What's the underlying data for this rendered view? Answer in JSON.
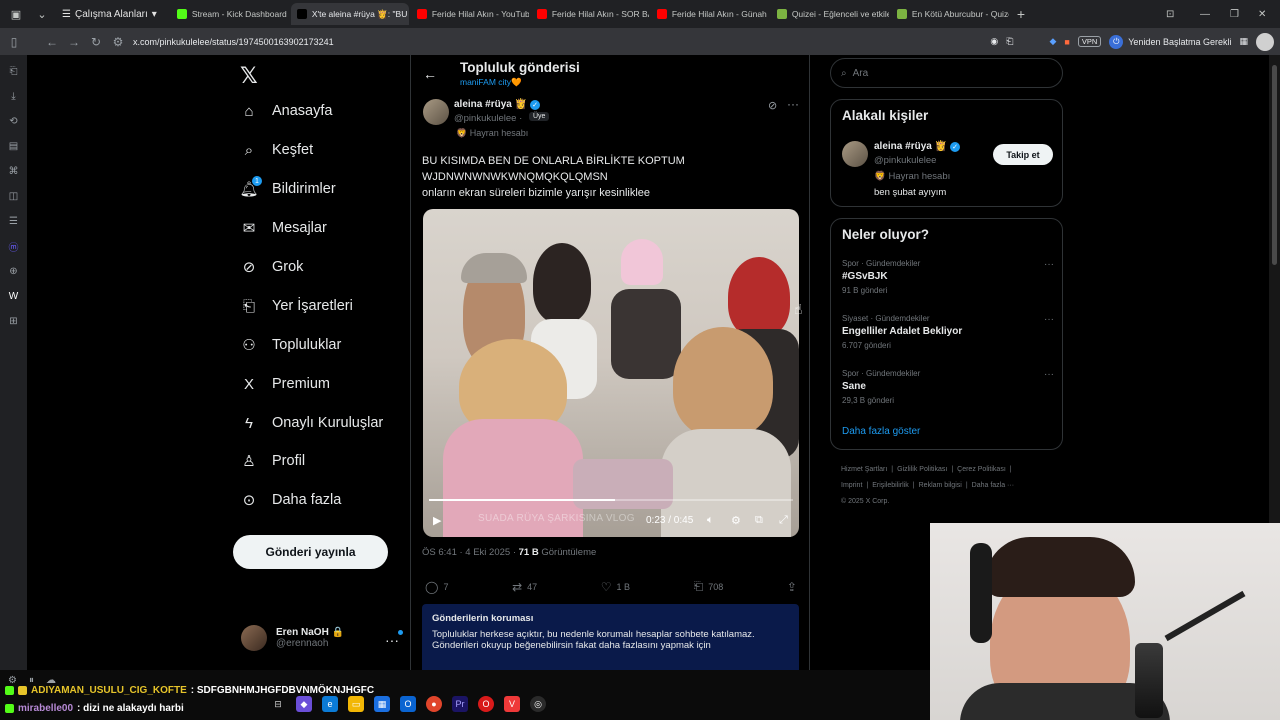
{
  "browser": {
    "workspace_label": "Çalışma Alanları",
    "tabs": [
      {
        "label": "Stream - Kick Dashboard",
        "color": "#53fc18",
        "active": false
      },
      {
        "label": "X'te aleina #rüya 👸: \"BU K",
        "color": "#000000",
        "active": true
      },
      {
        "label": "Feride Hilal Akın - YouTube",
        "color": "#ff0000",
        "active": false
      },
      {
        "label": "Feride Hilal Akın - SOR BAN",
        "color": "#ff0000",
        "active": false
      },
      {
        "label": "Feride Hilal Akın - Günah B",
        "color": "#ff0000",
        "active": false
      },
      {
        "label": "Quizei - Eğlenceli ve etkileş",
        "color": "#7cb342",
        "active": false
      },
      {
        "label": "En Kötü Aburcubur - Quizei",
        "color": "#7cb342",
        "active": false
      }
    ],
    "url": "x.com/pinkukulelee/status/1974500163902173241",
    "vpn_label": "VPN",
    "restart_label": "Yeniden Başlatma Gerekli"
  },
  "nav": {
    "items": [
      {
        "label": "Anasayfa",
        "icon": "home-icon",
        "glyph": "⌂"
      },
      {
        "label": "Keşfet",
        "icon": "search-icon",
        "glyph": "⌕"
      },
      {
        "label": "Bildirimler",
        "icon": "bell-icon",
        "glyph": "🔔︎"
      },
      {
        "label": "Mesajlar",
        "icon": "mail-icon",
        "glyph": "✉"
      },
      {
        "label": "Grok",
        "icon": "grok-icon",
        "glyph": "⊘"
      },
      {
        "label": "Yer İşaretleri",
        "icon": "bookmark-icon",
        "glyph": "⎗"
      },
      {
        "label": "Topluluklar",
        "icon": "communities-icon",
        "glyph": "⚇"
      },
      {
        "label": "Premium",
        "icon": "x-premium-icon",
        "glyph": "X"
      },
      {
        "label": "Onaylı Kuruluşlar",
        "icon": "lightning-icon",
        "glyph": "ϟ"
      },
      {
        "label": "Profil",
        "icon": "person-icon",
        "glyph": "♙"
      },
      {
        "label": "Daha fazla",
        "icon": "more-circle-icon",
        "glyph": "⊙"
      }
    ],
    "notif_count": "1",
    "post_button": "Gönderi yayınla",
    "account_name": "Eren NaOH 🔒",
    "account_handle": "@erennaoh"
  },
  "post": {
    "header_title": "Topluluk gönderisi",
    "header_sub": "maniFAM city🧡",
    "author_name": "aleina #rüya 👸",
    "author_handle": "@pinkukulelee ·",
    "member_badge": "Üye",
    "fan_label": "🦁 Hayran hesabı",
    "text_line1": "BU KISIMDA BEN DE ONLARLA BİRLİKTE KOPTUM",
    "text_line2": "WJDNWNWNWKWNQMQKQLQMSN",
    "text_line3": "onların ekran süreleri bizimle yarışır kesinliklee",
    "video_caption": "SUADA RÜYA ŞARKISINA VLOG",
    "video_time": "0:23 / 0:45",
    "video_progress": 0.51,
    "time": "ÖS 6:41 · 4 Eki 2025 ·",
    "views": "71 B",
    "views_label": "Görüntüleme",
    "replies": "7",
    "reposts": "47",
    "likes": "1 B",
    "bookmarks": "708",
    "notice_title": "Gönderilerin koruması",
    "notice_body": "Topluluklar herkese açıktır, bu nedenle korumalı hesaplar sohbete katılamaz. Gönderileri okuyup beğenebilirsin fakat daha fazlasını yapmak için"
  },
  "sidebar": {
    "search_placeholder": "Ara",
    "related_title": "Alakalı kişiler",
    "rel_name": "aleina #rüya 👸",
    "rel_handle": "@pinkukulelee",
    "rel_fan": "🦁 Hayran hesabı",
    "rel_bio": "ben şubat ayıyım",
    "follow_label": "Takip et",
    "trends_title": "Neler oluyor?",
    "trends": [
      {
        "cat": "Spor · Gündemdekiler",
        "name": "#GSvBJK",
        "count": "91 B gönderi"
      },
      {
        "cat": "Siyaset · Gündemdekiler",
        "name": "Engelliler Adalet Bekliyor",
        "count": "6.707 gönderi"
      },
      {
        "cat": "Spor · Gündemdekiler",
        "name": "Sane",
        "count": "29,3 B gönderi"
      }
    ],
    "show_more": "Daha fazla göster",
    "footer": [
      "Hizmet Şartları",
      "|",
      "Gizlilik Politikası",
      "|",
      "Çerez Politikası",
      "|",
      "Imprint",
      "|",
      "Erişilebilirlik",
      "|",
      "Reklam bilgisi",
      "|",
      "Daha fazla ···",
      "© 2025 X Corp."
    ]
  },
  "chat": {
    "user1": "ADIYAMAN_USULU_CIG_KOFTE",
    "msg1": ": SDFGBNHMJHGFDBVNMÖKNJHGFC",
    "user2": "mirabelle00",
    "msg2": ": dizi ne alakaydı harbi"
  }
}
